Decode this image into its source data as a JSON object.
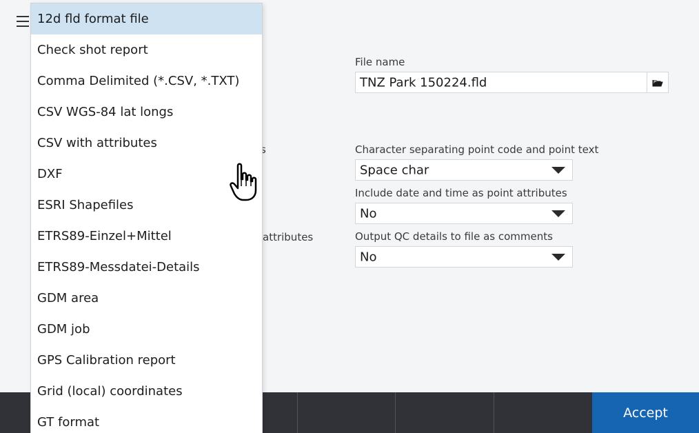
{
  "header": {
    "menu_icon": "hamburger-menu-icon"
  },
  "form": {
    "file_name_label": "File name",
    "file_name_value": "TNZ Park 150224.fld",
    "folder_icon": "folder-open-icon",
    "separator_label": "Character separating point code and point text",
    "separator_value": "Space char",
    "date_time_label": "Include date and time as point attributes",
    "date_time_value": "No",
    "qc_label": "Output QC details to file as comments",
    "qc_value": "No",
    "partial_label_1": "s",
    "partial_label_2": "attributes"
  },
  "dropdown": {
    "selected_index": 0,
    "items": [
      "12d fld format file",
      "Check shot report",
      "Comma Delimited (*.CSV, *.TXT)",
      "CSV WGS-84 lat longs",
      "CSV with attributes",
      "DXF",
      "ESRI Shapefiles",
      "ETRS89-Einzel+Mittel",
      "ETRS89-Messdatei-Details",
      "GDM area",
      "GDM job",
      "GPS Calibration report",
      "Grid (local) coordinates",
      "GT format"
    ]
  },
  "bottom_bar": {
    "accept_label": "Accept"
  },
  "colors": {
    "accent": "#1565b3",
    "selected_row": "#cfe2f1",
    "bottom_bar": "#303238",
    "background": "#f4f5f7"
  },
  "cursor_icon": "hand-pointer-icon"
}
